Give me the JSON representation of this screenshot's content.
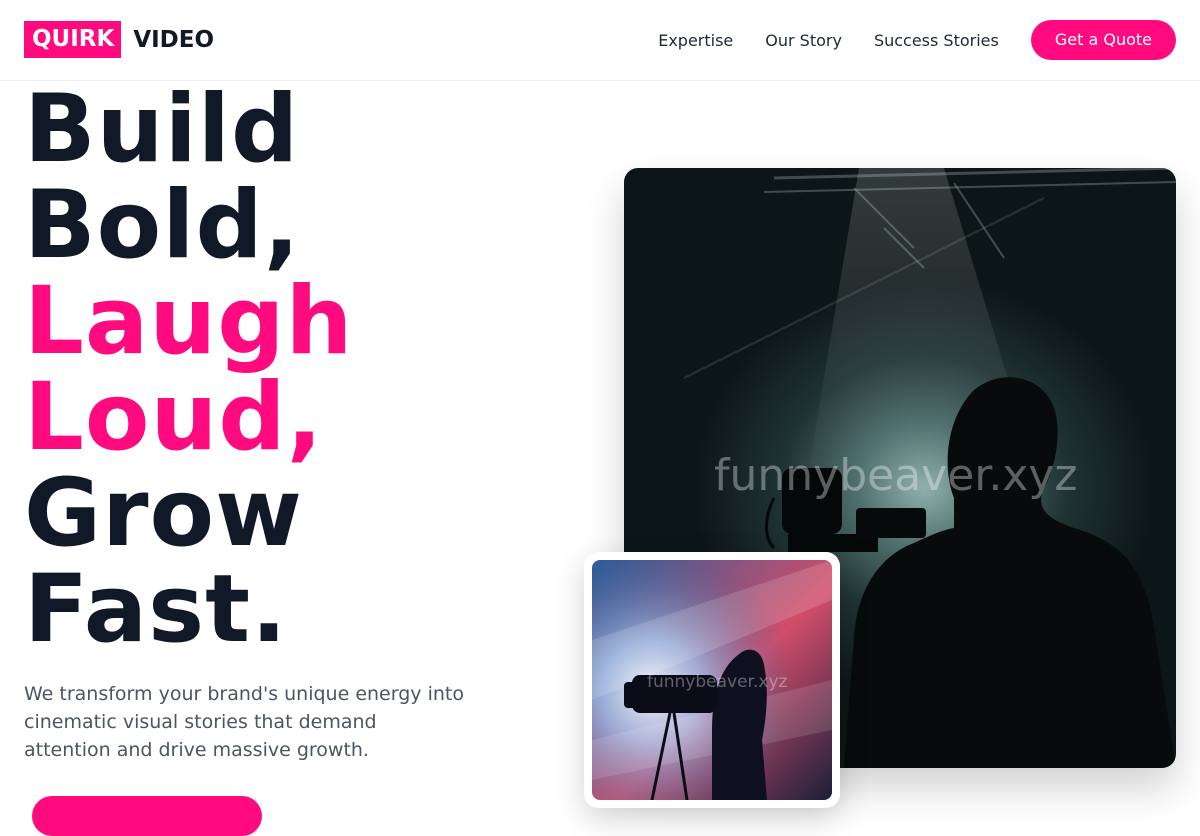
{
  "brand": {
    "badge": "QUIRK",
    "word": "VIDEO",
    "accent_color": "#ff0a7f"
  },
  "nav": {
    "links": [
      "Expertise",
      "Our Story",
      "Success Stories"
    ],
    "cta_label": "Get a Quote"
  },
  "hero": {
    "lines": [
      "Build",
      "Bold,",
      "Laugh",
      "Loud,",
      "Grow",
      "Fast."
    ],
    "subtitle": "We transform your brand's unique energy into cinematic visual stories that demand attention and drive massive growth."
  },
  "images": {
    "main_watermark": "funnybeaver.xyz",
    "thumb_watermark": "funnybeaver.xyz"
  }
}
